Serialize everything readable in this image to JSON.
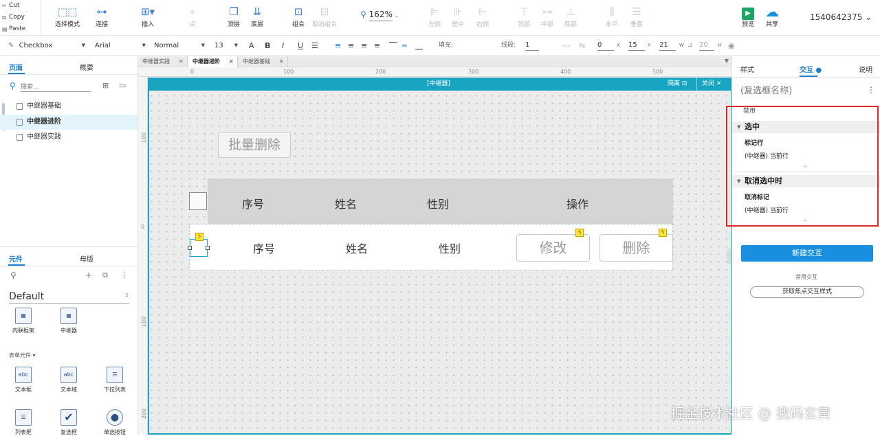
{
  "clipboard": {
    "cut": "Cut",
    "copy": "Copy",
    "paste": "Paste"
  },
  "toolbar": {
    "select_mode": "选择模式",
    "connect": "连接",
    "insert": "插入",
    "point": "点",
    "top_layer": "顶层",
    "bottom_layer": "底层",
    "group": "组合",
    "ungroup": "取消组合",
    "zoom": "162%",
    "align_left": "左侧",
    "align_center": "居中",
    "align_right": "右侧",
    "align_top": "顶部",
    "align_middle": "中部",
    "align_bottom": "底部",
    "dist_h": "水平",
    "dist_v": "垂直",
    "preview": "预览",
    "share": "共享",
    "user": "1540642375"
  },
  "format": {
    "widget_type": "Checkbox",
    "font": "Arial",
    "weight": "Normal",
    "size": "13",
    "fill_label": "填充:",
    "line_label": "线段:",
    "line_value": "1",
    "x": "0",
    "x_label": "X",
    "y": "15",
    "y_label": "Y",
    "w": "21",
    "w_label": "W",
    "h": "20",
    "h_label": "H"
  },
  "left": {
    "tab_pages": "页面",
    "tab_outline": "概要",
    "search_placeholder": "搜索...",
    "pages": [
      "中继器基础",
      "中继器进阶",
      "中继器实践"
    ],
    "tab_widgets": "元件",
    "tab_masters": "母版",
    "library": "Default",
    "w_inline_frame": "内联框架",
    "w_repeater": "中继器",
    "section_form": "表单元件 ▾",
    "w_textbox": "文本框",
    "w_textarea": "文本域",
    "w_dropdown": "下拉列表",
    "w_listbox": "列表框",
    "w_checkbox": "复选框",
    "w_radio": "单选按钮"
  },
  "doc_tabs": [
    "中继器实践",
    "中继器进阶",
    "中继器基础"
  ],
  "ruler": {
    "h": [
      "0",
      "100",
      "200",
      "300",
      "400",
      "500"
    ],
    "v": [
      "100",
      "0",
      "100",
      "200"
    ]
  },
  "frame": {
    "title": "[中继器]",
    "isolate": "隔离",
    "close": "关闭"
  },
  "canvas": {
    "bulk_delete": "批量删除",
    "header": {
      "no": "序号",
      "name": "姓名",
      "gender": "性别",
      "ops": "操作"
    },
    "row": {
      "no": "序号",
      "name": "姓名",
      "gender": "性别",
      "edit": "修改",
      "delete": "删除"
    }
  },
  "right": {
    "tab_style": "样式",
    "tab_interact": "交互",
    "tab_notes": "说明",
    "name_placeholder": "(复选框名称)",
    "disabled": "禁用",
    "event_checked": "选中",
    "act_mark": "标记行",
    "act_mark_target": "(中继器) 当前行",
    "event_unchecked": "取消选中时",
    "act_unmark": "取消标记",
    "act_unmark_target": "(中继器) 当前行",
    "new_interaction": "新建交互",
    "common": "常用交互",
    "focus_style": "获取焦点交互样式"
  },
  "watermark": "掘金技术社区 @ 我码玄黄",
  "colors": {
    "accent": "#1a7fd6",
    "repeater": "#19a4c2",
    "highlight": "#e02828"
  }
}
